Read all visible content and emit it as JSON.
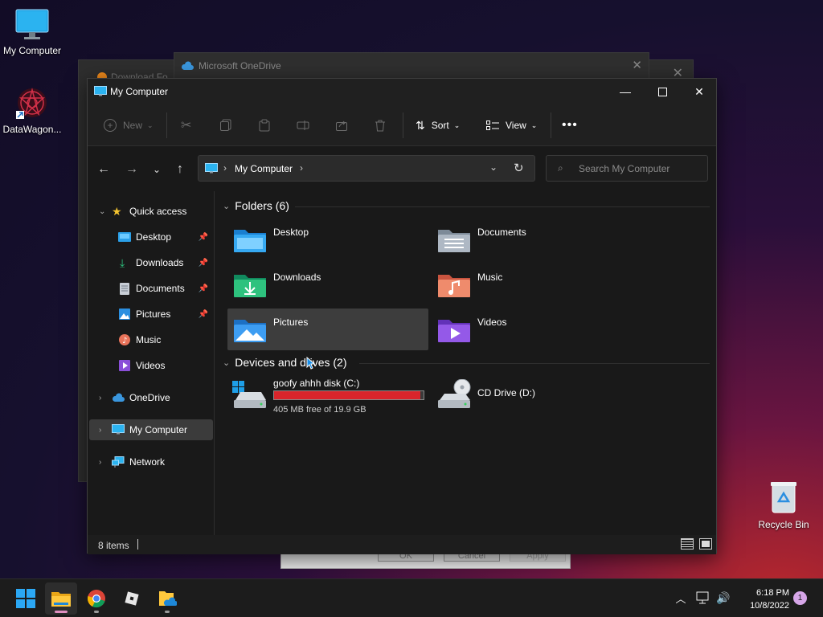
{
  "desktop": {
    "icons": [
      {
        "label": "My Computer"
      },
      {
        "label": "DataWagon..."
      },
      {
        "label": "Recycle Bin"
      }
    ]
  },
  "background_windows": {
    "onedrive_title": "Microsoft OneDrive",
    "download_title": "Download Fo",
    "dialog_buttons": [
      "OK",
      "Cancel",
      "Apply"
    ]
  },
  "explorer": {
    "title": "My Computer",
    "toolbar": {
      "new_label": "New",
      "sort_label": "Sort",
      "view_label": "View"
    },
    "address": {
      "segment": "My Computer"
    },
    "search": {
      "placeholder": "Search My Computer"
    },
    "sidebar": {
      "quick_access": "Quick access",
      "quick_items": [
        {
          "label": "Desktop",
          "pinned": true
        },
        {
          "label": "Downloads",
          "pinned": true
        },
        {
          "label": "Documents",
          "pinned": true
        },
        {
          "label": "Pictures",
          "pinned": true
        },
        {
          "label": "Music",
          "pinned": false
        },
        {
          "label": "Videos",
          "pinned": false
        }
      ],
      "onedrive": "OneDrive",
      "my_computer": "My Computer",
      "network": "Network"
    },
    "folders_heading": "Folders (6)",
    "folders": [
      {
        "label": "Desktop"
      },
      {
        "label": "Documents"
      },
      {
        "label": "Downloads"
      },
      {
        "label": "Music"
      },
      {
        "label": "Pictures"
      },
      {
        "label": "Videos"
      }
    ],
    "devices_heading": "Devices and drives (2)",
    "drives": [
      {
        "label": "goofy ahhh disk (C:)",
        "free_text": "405 MB free of 19.9 GB",
        "used_fraction": 0.98
      },
      {
        "label": "CD Drive (D:)"
      }
    ],
    "status": {
      "items": "8 items"
    }
  },
  "taskbar": {
    "clock_time": "6:18 PM",
    "clock_date": "10/8/2022",
    "notification_count": "1"
  },
  "colors": {
    "accent": "#4cc2ff",
    "drive_full": "#d9252b",
    "selection": "#3d3d3d"
  }
}
